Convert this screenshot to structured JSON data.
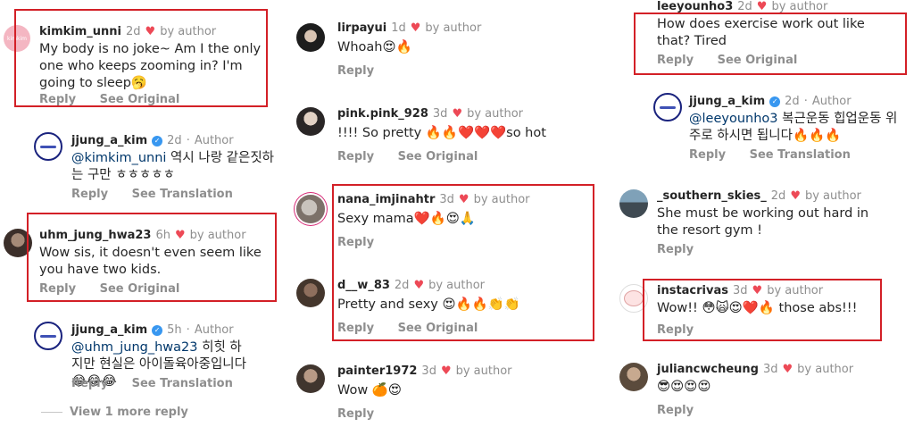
{
  "labels": {
    "reply": "Reply",
    "see_original": "See Original",
    "see_translation": "See Translation",
    "by_author": "by author",
    "author": "Author",
    "heart": "♥"
  },
  "col1": {
    "c1": {
      "user": "kimkim_unni",
      "time": "2d",
      "text": "My body is no joke~ Am I the only one who keeps zooming in? I'm going to sleep🥱"
    },
    "c2": {
      "user": "jjung_a_kim",
      "time": "2d",
      "mention": "@kimkim_unni",
      "text": " 역시 나랑 같은짓하는 구만 ㅎㅎㅎㅎㅎ"
    },
    "c3": {
      "user": "uhm_jung_hwa23",
      "time": "6h",
      "text": "Wow sis, it doesn't even seem like you have two kids."
    },
    "c4": {
      "user": "jjung_a_kim",
      "time": "5h",
      "mention": "@uhm_jung_hwa23",
      "text": " 히힛 하지만 현실은 아이돌육아중입니다😂😂😂"
    },
    "view_more": "View 1 more reply"
  },
  "col2": {
    "c1": {
      "user": "lirpayui",
      "time": "1d",
      "text": "Whoah😍🔥"
    },
    "c2": {
      "user": "pink.pink_928",
      "time": "3d",
      "text": "!!!! So pretty 🔥🔥❤️❤️❤️so hot"
    },
    "c3": {
      "user": "nana_imjinahtr",
      "time": "3d",
      "text": "Sexy mama❤️🔥😍🙏"
    },
    "c4": {
      "user": "d__w_83",
      "time": "2d",
      "text": "Pretty and sexy 😍🔥🔥👏👏"
    },
    "c5": {
      "user": "painter1972",
      "time": "3d",
      "text": "Wow 🍊😍"
    }
  },
  "col3": {
    "c1": {
      "user": "leeyounho3",
      "time": "2d",
      "text": "How does exercise work out like that? Tired"
    },
    "c2": {
      "user": "jjung_a_kim",
      "time": "2d",
      "mention": "@leeyounho3",
      "text": " 복근운동 힙업운동 위주로 하시면 됩니다🔥🔥🔥"
    },
    "c3": {
      "user": "_southern_skies_",
      "time": "2d",
      "text": "She must be working out hard in the resort gym !"
    },
    "c4": {
      "user": "instacrivas",
      "time": "3d",
      "text": "Wow!! 😳🙀😍❤️🔥 those abs!!!"
    },
    "c5": {
      "user": "juliancwcheung",
      "time": "3d",
      "text": "😎😍😍😍"
    }
  },
  "pink_avatar_text": "kimkim"
}
